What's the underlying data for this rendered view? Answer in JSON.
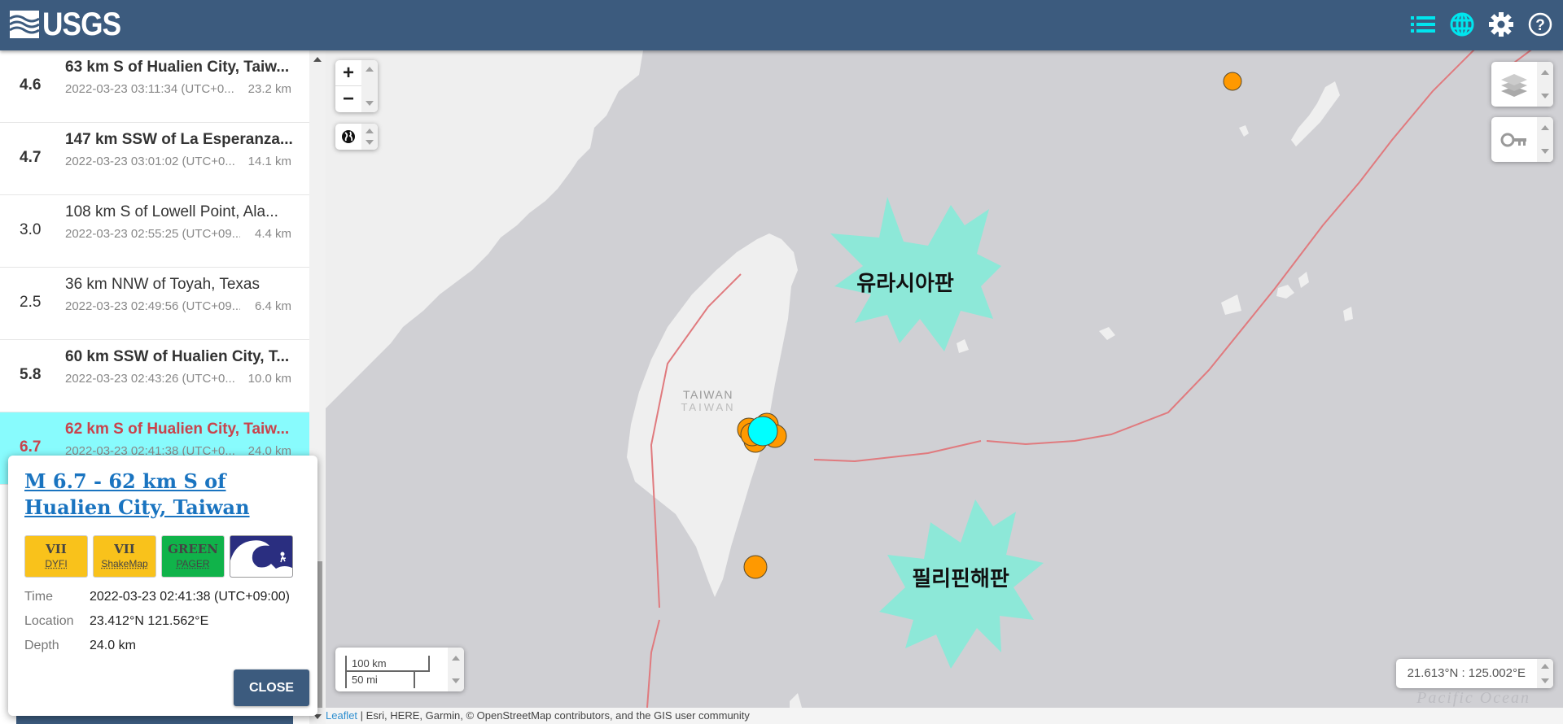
{
  "header": {
    "logo_text": "USGS",
    "icons": [
      "list-icon",
      "globe-icon",
      "gear-icon",
      "help-icon"
    ],
    "active_color": "#00e5ee"
  },
  "events": [
    {
      "mag": "4.6",
      "place": "63 km S of Hualien City, Taiw...",
      "time": "2022-03-23 03:11:34 (UTC+0...",
      "depth": "23.2 km",
      "significant": true,
      "selected": false
    },
    {
      "mag": "4.7",
      "place": "147 km SSW of La Esperanza...",
      "time": "2022-03-23 03:01:02 (UTC+0...",
      "depth": "14.1 km",
      "significant": true,
      "selected": false
    },
    {
      "mag": "3.0",
      "place": "108 km S of Lowell Point, Ala...",
      "time": "2022-03-23 02:55:25 (UTC+09...",
      "depth": "4.4 km",
      "significant": false,
      "selected": false
    },
    {
      "mag": "2.5",
      "place": "36 km NNW of Toyah, Texas",
      "time": "2022-03-23 02:49:56 (UTC+09...",
      "depth": "6.4 km",
      "significant": false,
      "selected": false
    },
    {
      "mag": "5.8",
      "place": "60 km SSW of Hualien City, T...",
      "time": "2022-03-23 02:43:26 (UTC+0...",
      "depth": "10.0 km",
      "significant": true,
      "selected": false
    },
    {
      "mag": "6.7",
      "place": "62 km S of Hualien City, Taiw...",
      "time": "2022-03-23 02:41:38 (UTC+0...",
      "depth": "24.0 km",
      "significant": true,
      "selected": true
    }
  ],
  "popup": {
    "title": "M 6.7 - 62 km S of Hualien City, Taiwan",
    "badges": [
      {
        "value": "VII",
        "label": "DYFI",
        "color": "#f9c21b"
      },
      {
        "value": "VII",
        "label": "ShakeMap",
        "color": "#f9c21b"
      },
      {
        "value": "GREEN",
        "label": "PAGER",
        "color": "#10b34a"
      }
    ],
    "tsunami_icon": "tsunami-icon",
    "details": [
      {
        "key": "Time",
        "value": "2022-03-23 02:41:38 (UTC+09:00)"
      },
      {
        "key": "Location",
        "value": "23.412°N 121.562°E"
      },
      {
        "key": "Depth",
        "value": "24.0 km"
      }
    ],
    "close_label": "CLOSE"
  },
  "map": {
    "zoom_in": "+",
    "zoom_out": "−",
    "scale_km": "100 km",
    "scale_mi": "50 mi",
    "coords": "21.613°N : 125.002°E",
    "country_label": "TAIWAN",
    "country_label_local": "TAIWAN",
    "ocean_label": "Pacific Ocean",
    "plate_labels": {
      "eurasian": "유라시아판",
      "philippine": "필리핀해판"
    },
    "burst_color": "#8de8d8",
    "plate_line_color": "#e07a7e",
    "event_color": "#ff9900",
    "selected_event_color": "#00ffff"
  },
  "attribution": {
    "leaflet": "Leaflet",
    "text": " | Esri, HERE, Garmin, © OpenStreetMap contributors, and the GIS user community"
  }
}
